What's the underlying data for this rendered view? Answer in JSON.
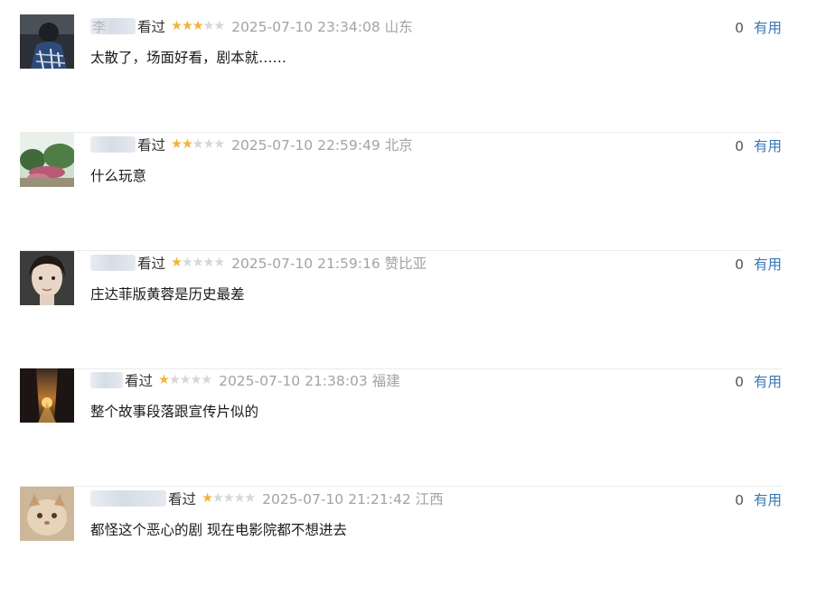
{
  "reviews": [
    {
      "name_fragment": "李",
      "watched_label": "看过",
      "rating": 3,
      "rating_max": 5,
      "time": "2025-07-10 23:34:08",
      "location": "山东",
      "comment": "太散了，场面好看，剧本就……",
      "useful_count": "0",
      "useful_label": "有用"
    },
    {
      "name_fragment": "",
      "watched_label": "看过",
      "rating": 2,
      "rating_max": 5,
      "time": "2025-07-10 22:59:49",
      "location": "北京",
      "comment": "什么玩意",
      "useful_count": "0",
      "useful_label": "有用"
    },
    {
      "name_fragment": "",
      "watched_label": "看过",
      "rating": 1,
      "rating_max": 5,
      "time": "2025-07-10 21:59:16",
      "location": "赞比亚",
      "comment": "庄达菲版黄蓉是历史最差",
      "useful_count": "0",
      "useful_label": "有用"
    },
    {
      "name_fragment": "",
      "watched_label": "看过",
      "rating": 1,
      "rating_max": 5,
      "time": "2025-07-10 21:38:03",
      "location": "福建",
      "comment": "整个故事段落跟宣传片似的",
      "useful_count": "0",
      "useful_label": "有用"
    },
    {
      "name_fragment": "",
      "watched_label": "看过",
      "rating": 1,
      "rating_max": 5,
      "time": "2025-07-10 21:21:42",
      "location": "江西",
      "comment": "都怪这个恶心的剧 现在电影院都不想进去",
      "useful_count": "0",
      "useful_label": "有用"
    }
  ],
  "colors": {
    "star_on": "#f4b43a",
    "star_off": "#d7d7d7",
    "link": "#3a7ab8",
    "timestamp": "#a3a3a3",
    "divider": "#ececec"
  },
  "icons": {
    "star": "star-icon",
    "avatar": "avatar-image"
  }
}
